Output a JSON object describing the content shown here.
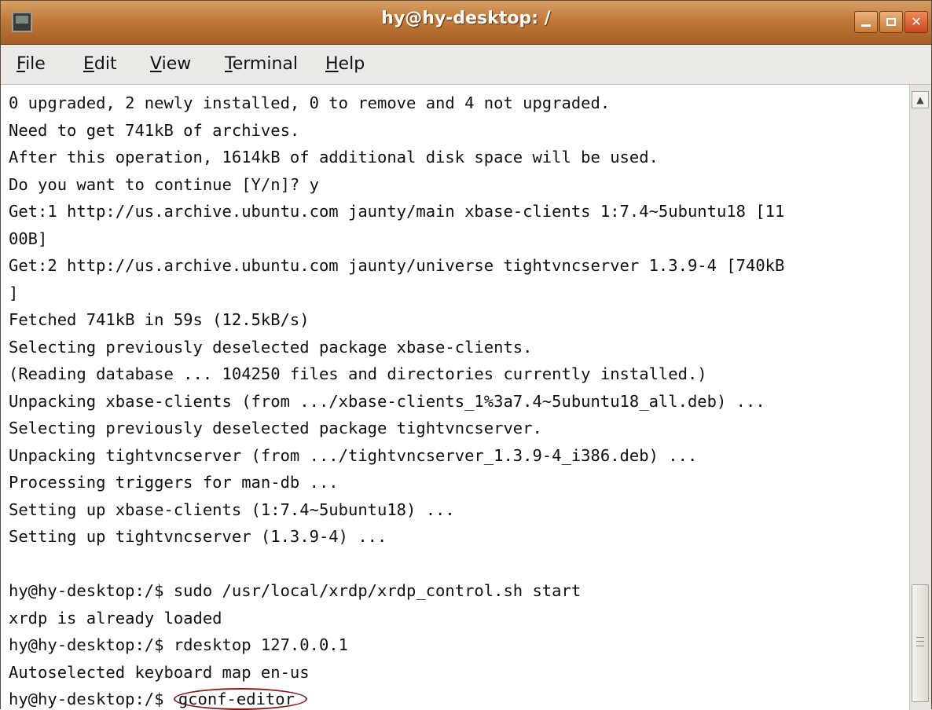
{
  "window": {
    "title": "hy@hy-desktop: /"
  },
  "menubar": {
    "items": [
      {
        "mnemonic": "F",
        "rest": "ile"
      },
      {
        "mnemonic": "E",
        "rest": "dit"
      },
      {
        "mnemonic": "V",
        "rest": "iew"
      },
      {
        "mnemonic": "T",
        "rest": "erminal"
      },
      {
        "mnemonic": "H",
        "rest": "elp"
      }
    ]
  },
  "terminal": {
    "lines": [
      "0 upgraded, 2 newly installed, 0 to remove and 4 not upgraded.",
      "Need to get 741kB of archives.",
      "After this operation, 1614kB of additional disk space will be used.",
      "Do you want to continue [Y/n]? y",
      "Get:1 http://us.archive.ubuntu.com jaunty/main xbase-clients 1:7.4~5ubuntu18 [11",
      "00B]",
      "Get:2 http://us.archive.ubuntu.com jaunty/universe tightvncserver 1.3.9-4 [740kB",
      "]",
      "Fetched 741kB in 59s (12.5kB/s)",
      "Selecting previously deselected package xbase-clients.",
      "(Reading database ... 104250 files and directories currently installed.)",
      "Unpacking xbase-clients (from .../xbase-clients_1%3a7.4~5ubuntu18_all.deb) ...",
      "Selecting previously deselected package tightvncserver.",
      "Unpacking tightvncserver (from .../tightvncserver_1.3.9-4_i386.deb) ...",
      "Processing triggers for man-db ...",
      "Setting up xbase-clients (1:7.4~5ubuntu18) ...",
      "Setting up tightvncserver (1.3.9-4) ...",
      "",
      "hy@hy-desktop:/$ sudo /usr/local/xrdp/xrdp_control.sh start",
      "xrdp is already loaded",
      "hy@hy-desktop:/$ rdesktop 127.0.0.1",
      "Autoselected keyboard map en-us"
    ],
    "prompt": "hy@hy-desktop:/$ ",
    "highlighted_command": "gconf-editor"
  },
  "icons": {
    "window_icon": "terminal-icon",
    "minimize": "minimize-icon",
    "maximize": "maximize-icon",
    "close": "close-icon",
    "scroll_up": "arrow-up-icon"
  }
}
